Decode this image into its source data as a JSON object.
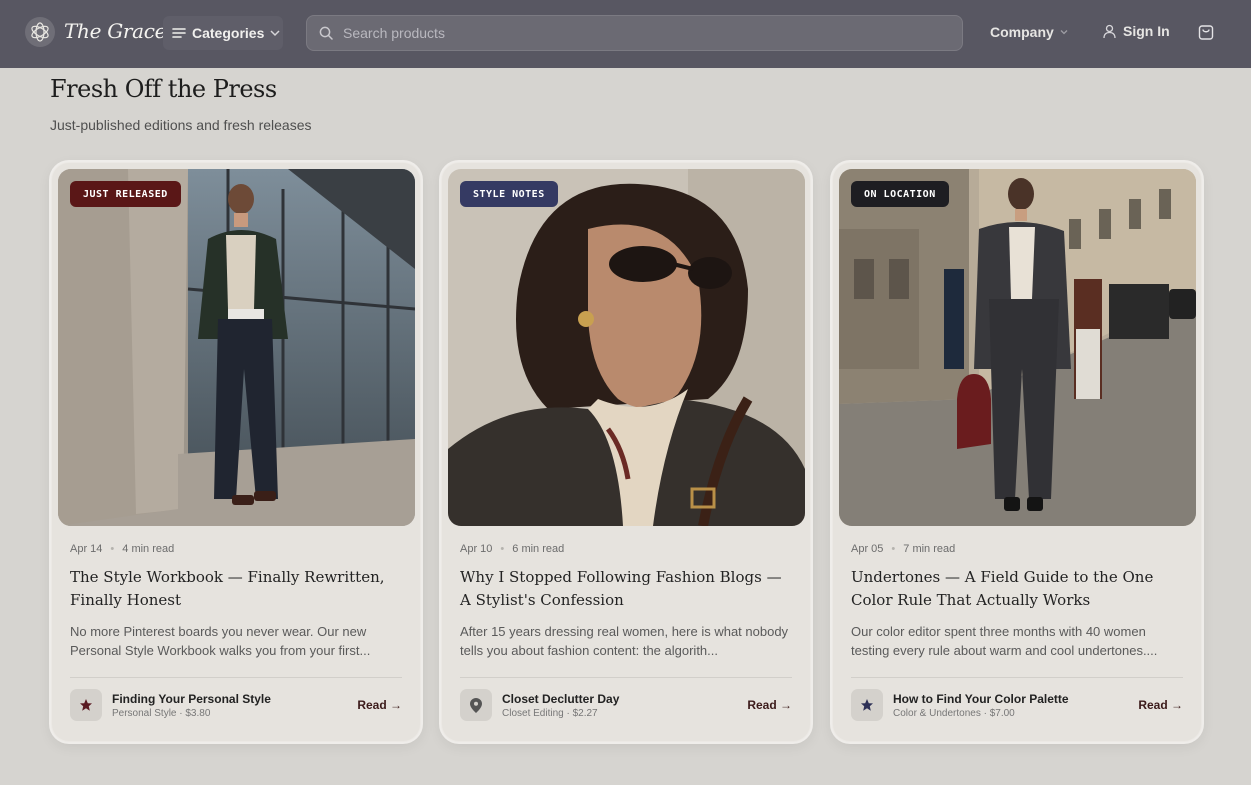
{
  "header": {
    "brand": "The Grace",
    "categories_label": "Categories",
    "search_placeholder": "Search products",
    "company_label": "Company",
    "signin_label": "Sign In"
  },
  "section": {
    "title": "Fresh Off the Press",
    "subtitle": "Just-published editions and fresh releases"
  },
  "cards": [
    {
      "badge": "JUST RELEASED",
      "badge_color": "#5a1717",
      "date": "Apr 14",
      "read_time": "4 min read",
      "title": "The Style Workbook — Finally Rewritten, Finally Honest",
      "excerpt": "No more Pinterest boards you never wear. Our new Personal Style Workbook walks you from your first...",
      "product_name": "Finding Your Personal Style",
      "product_meta": "Personal Style · $3.80",
      "product_icon": "star-icon",
      "read_label": "Read →"
    },
    {
      "badge": "STYLE NOTES",
      "badge_color": "#353a63",
      "date": "Apr 10",
      "read_time": "6 min read",
      "title": "Why I Stopped Following Fashion Blogs — A Stylist's Confession",
      "excerpt": "After 15 years dressing real women, here is what nobody tells you about fashion content: the algorith...",
      "product_name": "Closet Declutter Day",
      "product_meta": "Closet Editing · $2.27",
      "product_icon": "location-pin-icon",
      "read_label": "Read →"
    },
    {
      "badge": "ON LOCATION",
      "badge_color": "#1e1e22",
      "date": "Apr 05",
      "read_time": "7 min read",
      "title": "Undertones — A Field Guide to the One Color Rule That Actually Works",
      "excerpt": "Our color editor spent three months with 40 women testing every rule about warm and cool undertones....",
      "product_name": "How to Find Your Color Palette",
      "product_meta": "Color & Undertones · $7.00",
      "product_icon": "star-icon",
      "read_label": "Read →"
    }
  ]
}
